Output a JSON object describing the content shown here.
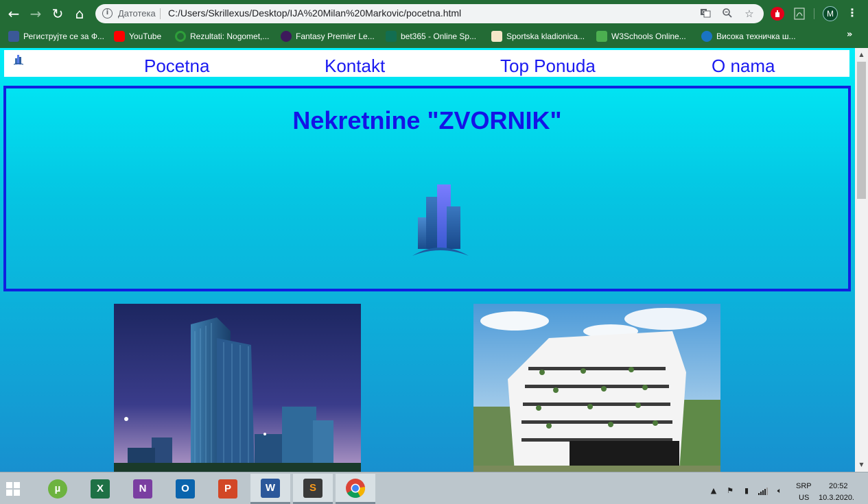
{
  "browser": {
    "security_label": "Датотека",
    "url": "C:/Users/Skrillexus/Desktop/IJA%20Milan%20Markovic/pocetna.html",
    "profile_initial": "M",
    "bookmarks": [
      {
        "label": "Региструјте се за Ф...",
        "icon": "facebook-icon",
        "color": "#3b5998"
      },
      {
        "label": "YouTube",
        "icon": "youtube-icon",
        "color": "#ff0000"
      },
      {
        "label": "Rezultati: Nogomet,...",
        "icon": "rezultati-icon",
        "color": "#2e9e3a"
      },
      {
        "label": "Fantasy Premier Le...",
        "icon": "premier-league-icon",
        "color": "#3d195b"
      },
      {
        "label": "bet365 - Online Sp...",
        "icon": "bet365-icon",
        "color": "#126e51"
      },
      {
        "label": "Sportska kladionica...",
        "icon": "kladionica-icon",
        "color": "#f5e6c8"
      },
      {
        "label": "W3Schools Online...",
        "icon": "w3schools-icon",
        "color": "#4caf50"
      },
      {
        "label": "Висока техничка ш...",
        "icon": "school-icon",
        "color": "#1a74c4"
      }
    ],
    "more_bookmarks": "»"
  },
  "page": {
    "nav": [
      "Pocetna",
      "Kontakt",
      "Top Ponuda",
      "O nama"
    ],
    "hero_title": "Nekretnine \"ZVORNIK\"",
    "colors": {
      "link": "#1a1af0",
      "title": "#1414e6",
      "border": "#1020e0"
    }
  },
  "taskbar": {
    "apps": [
      {
        "name": "utorrent",
        "letter": "µ",
        "color": "#6db33f"
      },
      {
        "name": "excel",
        "letter": "X",
        "color": "#1e7145"
      },
      {
        "name": "onenote",
        "letter": "N",
        "color": "#7a3ea1"
      },
      {
        "name": "outlook",
        "letter": "O",
        "color": "#0a64ad"
      },
      {
        "name": "powerpoint",
        "letter": "P",
        "color": "#d24726"
      },
      {
        "name": "word",
        "letter": "W",
        "color": "#2b579a"
      },
      {
        "name": "sublime",
        "letter": "S",
        "color": "#3a3a3a"
      },
      {
        "name": "chrome",
        "letter": "",
        "color": "#ffffff"
      }
    ],
    "language": "SRP",
    "layout": "US",
    "time": "20:52",
    "date": "10.3.2020."
  }
}
